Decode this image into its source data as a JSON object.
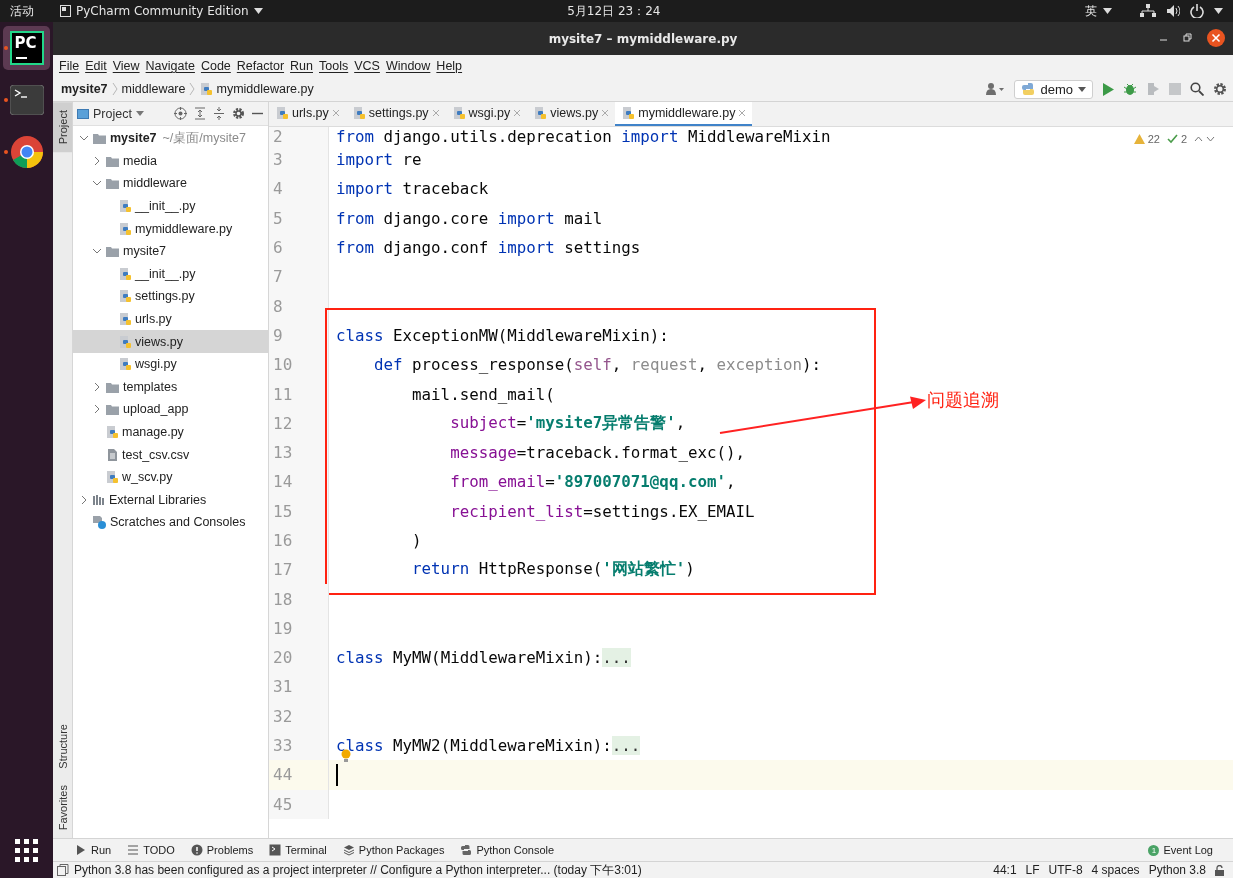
{
  "top_bar": {
    "activities": "活动",
    "app_menu": "PyCharm Community Edition",
    "clock": "5月12日 23：24",
    "input_method": "英"
  },
  "dock": [
    {
      "kind": "pycharm",
      "label": "PC",
      "selected": true
    },
    {
      "kind": "terminal",
      "selected": false
    },
    {
      "kind": "browser",
      "selected": false
    },
    {
      "kind": "apps",
      "selected": false
    }
  ],
  "window": {
    "title": "mysite7 – mymiddleware.py"
  },
  "menu": [
    "File",
    "Edit",
    "View",
    "Navigate",
    "Code",
    "Refactor",
    "Run",
    "Tools",
    "VCS",
    "Window",
    "Help"
  ],
  "breadcrumb": [
    {
      "label": "mysite7",
      "kind": "project"
    },
    {
      "label": "middleware",
      "kind": "folder"
    },
    {
      "label": "mymiddleware.py",
      "kind": "pyfile"
    }
  ],
  "run_config": "demo",
  "side_tabs": [
    {
      "label": "Project",
      "selected": true
    },
    {
      "label": "Structure",
      "selected": false
    },
    {
      "label": "Favorites",
      "selected": false
    }
  ],
  "project_panel": {
    "title": "Project",
    "tree": [
      {
        "label": "mysite7",
        "hint": "~/桌面/mysite7",
        "kind": "folder",
        "expanded": true,
        "selected": false,
        "children": [
          {
            "label": "media",
            "kind": "folder",
            "expanded": false,
            "selected": false
          },
          {
            "label": "middleware",
            "kind": "folder",
            "expanded": true,
            "selected": false,
            "children": [
              {
                "label": "__init__.py",
                "kind": "pyfile",
                "selected": false
              },
              {
                "label": "mymiddleware.py",
                "kind": "pyfile",
                "selected": false
              }
            ]
          },
          {
            "label": "mysite7",
            "kind": "folder",
            "expanded": true,
            "selected": false,
            "children": [
              {
                "label": "__init__.py",
                "kind": "pyfile",
                "selected": false
              },
              {
                "label": "settings.py",
                "kind": "pyfile",
                "selected": false
              },
              {
                "label": "urls.py",
                "kind": "pyfile",
                "selected": false
              },
              {
                "label": "views.py",
                "kind": "pyfile",
                "selected": true
              },
              {
                "label": "wsgi.py",
                "kind": "pyfile",
                "selected": false
              }
            ]
          },
          {
            "label": "templates",
            "kind": "folder",
            "expanded": false,
            "selected": false
          },
          {
            "label": "upload_app",
            "kind": "folder",
            "expanded": false,
            "selected": false
          },
          {
            "label": "manage.py",
            "kind": "pyfile",
            "selected": false
          },
          {
            "label": "test_csv.csv",
            "kind": "csvfile",
            "selected": false
          },
          {
            "label": "w_scv.py",
            "kind": "pyfile",
            "selected": false
          }
        ]
      },
      {
        "label": "External Libraries",
        "kind": "libs",
        "expanded": false,
        "selected": false
      },
      {
        "label": "Scratches and Consoles",
        "kind": "scratch",
        "selected": false
      }
    ]
  },
  "tabs": [
    {
      "label": "urls.py",
      "selected": false
    },
    {
      "label": "settings.py",
      "selected": false
    },
    {
      "label": "wsgi.py",
      "selected": false
    },
    {
      "label": "views.py",
      "selected": false
    },
    {
      "label": "mymiddleware.py",
      "selected": true
    }
  ],
  "inspections": {
    "warnings": "22",
    "ok": "2"
  },
  "code_lines": [
    {
      "number": "2",
      "current": false,
      "boxed": false,
      "tokens": [
        {
          "kind": "keyword",
          "text": "from"
        },
        {
          "kind": "plain",
          "text": " django.utils.deprecation "
        },
        {
          "kind": "keyword",
          "text": "import"
        },
        {
          "kind": "plain",
          "text": " MiddlewareMixin"
        }
      ]
    },
    {
      "number": "3",
      "current": false,
      "boxed": false,
      "tokens": [
        {
          "kind": "keyword",
          "text": "import"
        },
        {
          "kind": "plain",
          "text": " re"
        }
      ]
    },
    {
      "number": "4",
      "current": false,
      "boxed": false,
      "tokens": [
        {
          "kind": "keyword",
          "text": "import"
        },
        {
          "kind": "plain",
          "text": " traceback"
        }
      ]
    },
    {
      "number": "5",
      "current": false,
      "boxed": false,
      "tokens": [
        {
          "kind": "keyword",
          "text": "from"
        },
        {
          "kind": "plain",
          "text": " django.core "
        },
        {
          "kind": "keyword",
          "text": "import"
        },
        {
          "kind": "plain",
          "text": " mail"
        }
      ]
    },
    {
      "number": "6",
      "current": false,
      "boxed": false,
      "tokens": [
        {
          "kind": "keyword",
          "text": "from"
        },
        {
          "kind": "plain",
          "text": " django.conf "
        },
        {
          "kind": "keyword",
          "text": "import"
        },
        {
          "kind": "plain",
          "text": " settings"
        }
      ]
    },
    {
      "number": "7",
      "current": false,
      "boxed": false
    },
    {
      "number": "8",
      "current": false,
      "boxed": false
    },
    {
      "number": "9",
      "current": false,
      "boxed": true,
      "tokens": [
        {
          "kind": "keyword",
          "text": "class"
        },
        {
          "kind": "plain",
          "text": " ExceptionMW(MiddlewareMixin):"
        }
      ]
    },
    {
      "number": "10",
      "current": false,
      "boxed": true,
      "tokens": [
        {
          "kind": "keyword",
          "text": "    def"
        },
        {
          "kind": "plain",
          "text": " process_response("
        },
        {
          "kind": "self",
          "text": "self"
        },
        {
          "kind": "plain",
          "text": ", "
        },
        {
          "kind": "unused",
          "text": "request"
        },
        {
          "kind": "plain",
          "text": ", "
        },
        {
          "kind": "unused",
          "text": "exception"
        },
        {
          "kind": "plain",
          "text": "):"
        }
      ]
    },
    {
      "number": "11",
      "current": false,
      "boxed": true,
      "tokens": [
        {
          "kind": "plain",
          "text": "        mail.send_mail("
        }
      ]
    },
    {
      "number": "12",
      "current": false,
      "boxed": true,
      "tokens": [
        {
          "kind": "param",
          "text": "            subject"
        },
        {
          "kind": "plain",
          "text": "="
        },
        {
          "kind": "string",
          "text": "'mysite7异常告警'"
        },
        {
          "kind": "plain",
          "text": ","
        }
      ]
    },
    {
      "number": "13",
      "current": false,
      "boxed": true,
      "tokens": [
        {
          "kind": "param",
          "text": "            message"
        },
        {
          "kind": "plain",
          "text": "=traceback.format_exc(),"
        }
      ]
    },
    {
      "number": "14",
      "current": false,
      "boxed": true,
      "tokens": [
        {
          "kind": "param",
          "text": "            from_email"
        },
        {
          "kind": "plain",
          "text": "="
        },
        {
          "kind": "string",
          "text": "'897007071@qq.com'"
        },
        {
          "kind": "plain",
          "text": ","
        }
      ]
    },
    {
      "number": "15",
      "current": false,
      "boxed": true,
      "tokens": [
        {
          "kind": "param",
          "text": "            recipient_list"
        },
        {
          "kind": "plain",
          "text": "=settings.EX_EMAIL"
        }
      ]
    },
    {
      "number": "16",
      "current": false,
      "boxed": true,
      "tokens": [
        {
          "kind": "plain",
          "text": "        )"
        }
      ]
    },
    {
      "number": "17",
      "current": false,
      "boxed": true,
      "tokens": [
        {
          "kind": "keyword",
          "text": "        return"
        },
        {
          "kind": "plain",
          "text": " HttpResponse("
        },
        {
          "kind": "string",
          "text": "'网站繁忙'"
        },
        {
          "kind": "plain",
          "text": ")"
        }
      ]
    },
    {
      "number": "18",
      "current": false,
      "boxed": false
    },
    {
      "number": "19",
      "current": false,
      "boxed": false
    },
    {
      "number": "20",
      "current": false,
      "boxed": false,
      "tokens": [
        {
          "kind": "keyword",
          "text": "class"
        },
        {
          "kind": "plain",
          "text": " MyMW(MiddlewareMixin):"
        },
        {
          "kind": "folded",
          "text": "..."
        }
      ]
    },
    {
      "number": "31",
      "current": false,
      "boxed": false
    },
    {
      "number": "32",
      "current": false,
      "boxed": false
    },
    {
      "number": "33",
      "current": false,
      "boxed": false,
      "tokens": [
        {
          "kind": "keyword",
          "text": "class"
        },
        {
          "kind": "plain",
          "text": " MyMW2(MiddlewareMixin):"
        },
        {
          "kind": "folded",
          "text": "..."
        }
      ]
    },
    {
      "number": "44",
      "current": true,
      "boxed": false
    },
    {
      "number": "45",
      "current": false,
      "boxed": false
    }
  ],
  "annotation": {
    "label": "问题追溯"
  },
  "tool_windows": [
    {
      "label": "Run",
      "kind": "run"
    },
    {
      "label": "TODO",
      "kind": "todo"
    },
    {
      "label": "Problems",
      "kind": "problems"
    },
    {
      "label": "Terminal",
      "kind": "terminal"
    },
    {
      "label": "Python Packages",
      "kind": "packages"
    },
    {
      "label": "Python Console",
      "kind": "console"
    }
  ],
  "event_log": {
    "label": "Event Log",
    "count": "1"
  },
  "status_bar": {
    "message": "Python 3.8 has been configured as a project interpreter // Configure a Python interpreter... (today 下午3:01)",
    "items": [
      "44:1",
      "LF",
      "UTF-8",
      "4 spaces",
      "Python 3.8"
    ]
  }
}
